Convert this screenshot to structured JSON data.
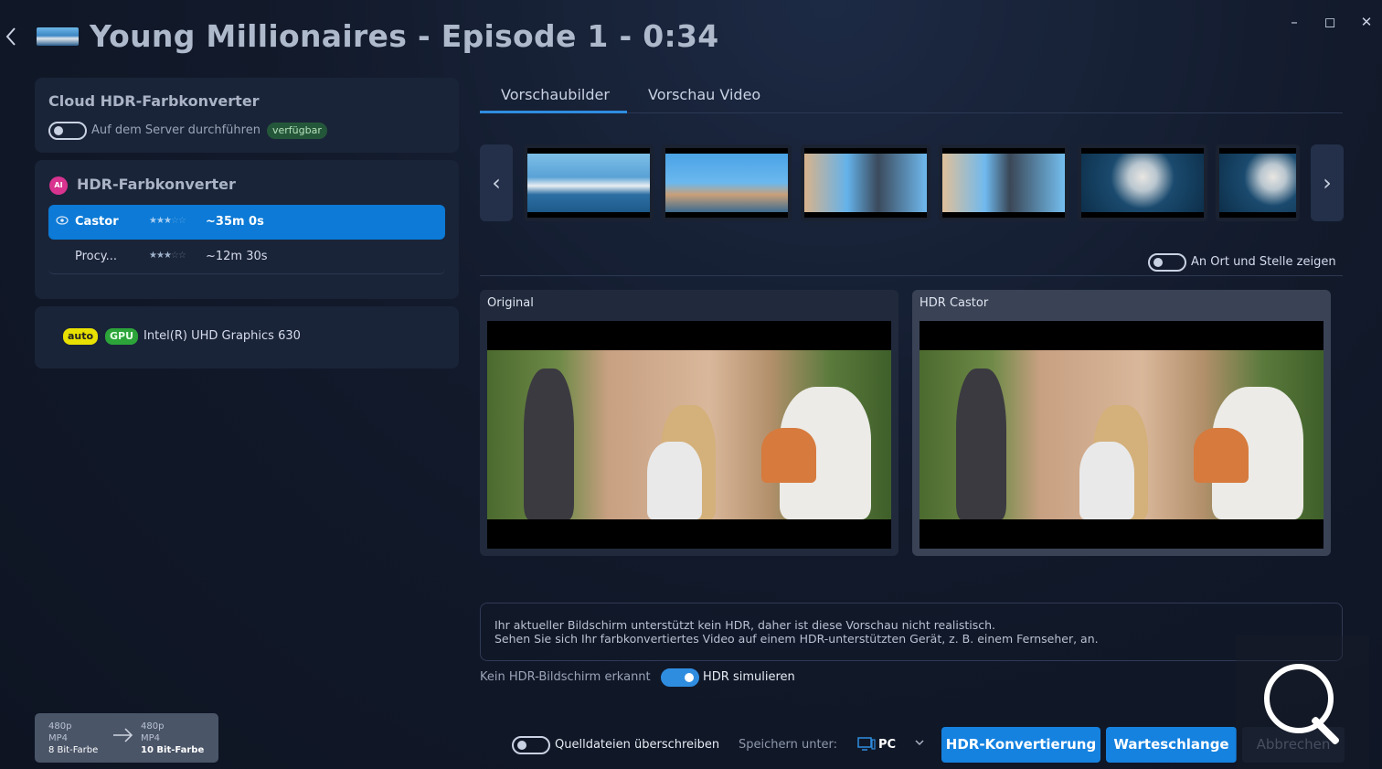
{
  "window": {
    "title": "Young Millionaires - Episode 1 - 0:34",
    "back_icon": "chevron-left-icon",
    "controls": {
      "minimize": "–",
      "maximize": "◻",
      "close": "✕"
    }
  },
  "cloud": {
    "title": "Cloud HDR-Farbkonverter",
    "toggle_label": "Auf dem Server durchführen",
    "toggle_on": false,
    "badge": "verfügbar"
  },
  "hdr_converter": {
    "icon_text": "AI",
    "title": "HDR-Farbkonverter",
    "options": [
      {
        "name": "Castor",
        "stars": "☆☆☆☆☆",
        "rating": 3,
        "time": "~35m 0s",
        "selected": true
      },
      {
        "name": "Procy...",
        "stars": "☆☆☆☆☆",
        "rating": 3,
        "time": "~12m 30s",
        "selected": false
      }
    ]
  },
  "gpu": {
    "auto_badge": "auto",
    "gpu_badge": "GPU",
    "name": "Intel(R) UHD Graphics 630"
  },
  "format": {
    "source": {
      "res": "480p",
      "container": "MP4",
      "depth": "8 Bit-Farbe"
    },
    "target": {
      "res": "480p",
      "container": "MP4",
      "depth": "10 Bit-Farbe"
    }
  },
  "tabs": [
    {
      "label": "Vorschaubilder",
      "active": true
    },
    {
      "label": "Vorschau Video",
      "active": false
    }
  ],
  "filmstrip": {
    "frame_count": 6,
    "prev_icon": "‹",
    "next_icon": "›"
  },
  "inplace": {
    "label": "An Ort und Stelle zeigen",
    "on": false
  },
  "previews": {
    "original_label": "Original",
    "hdr_label": "HDR Castor"
  },
  "info": {
    "line1": "Ihr aktueller Bildschirm unterstützt kein HDR, daher ist diese Vorschau nicht realistisch.",
    "line2": "Sehen Sie sich Ihr farbkonvertiertes Video auf einem HDR-unterstützten Gerät, z. B. einem Fernseher, an."
  },
  "hdr_sim": {
    "status": "Kein HDR-Bildschirm erkannt",
    "label": "HDR simulieren",
    "on": true
  },
  "bottom": {
    "overwrite_label": "Quelldateien überschreiben",
    "overwrite_on": false,
    "save_label": "Speichern unter:",
    "save_target": "PC",
    "convert_button": "HDR-Konvertierung",
    "queue_button": "Warteschlange",
    "cancel_button": "Abbrechen"
  },
  "colors": {
    "accent": "#1582e0",
    "background": "#121a2b",
    "card": "#1a2438",
    "badge_available": "#24573a",
    "badge_auto": "#e8e000",
    "badge_gpu": "#2ca43a",
    "ai_icon": "#d8338f"
  }
}
